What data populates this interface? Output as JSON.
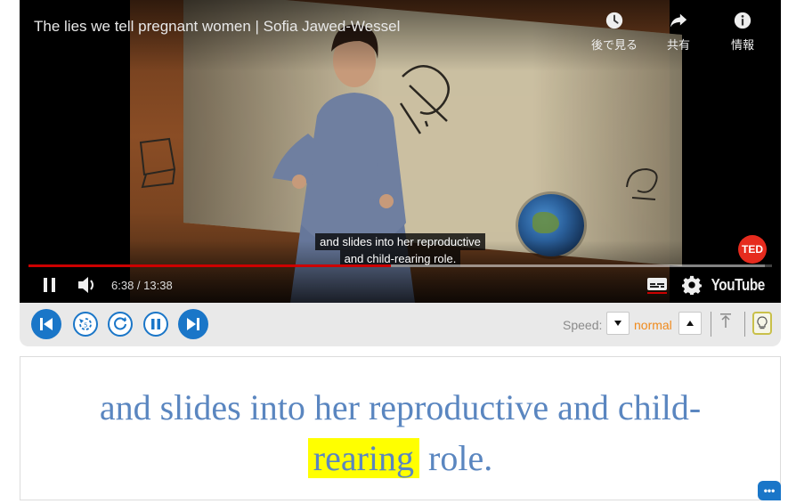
{
  "video": {
    "title": "The lies we tell pregnant women | Sofia Jawed-Wessel",
    "actions": [
      {
        "icon": "clock-icon",
        "label": "後で見る"
      },
      {
        "icon": "share-icon",
        "label": "共有"
      },
      {
        "icon": "info-icon",
        "label": "情報"
      }
    ],
    "caption_line1": "and slides into her reproductive",
    "caption_line2": "and child-rearing role.",
    "badge": "TED",
    "time_display": "6:38 / 13:38",
    "progress_played_fraction": 0.487,
    "progress_loaded_fraction": 0.99,
    "brand": "YouTube"
  },
  "controls": {
    "speed_label": "Speed:",
    "speed_value": "normal",
    "accent_color": "#1a76c8"
  },
  "transcript": {
    "before": "and slides into her reproductive and child-",
    "highlight": "rearing",
    "after": "role.",
    "text_color": "#5a86c0",
    "highlight_color": "#ffff00"
  },
  "chat": {
    "label": "•••"
  }
}
